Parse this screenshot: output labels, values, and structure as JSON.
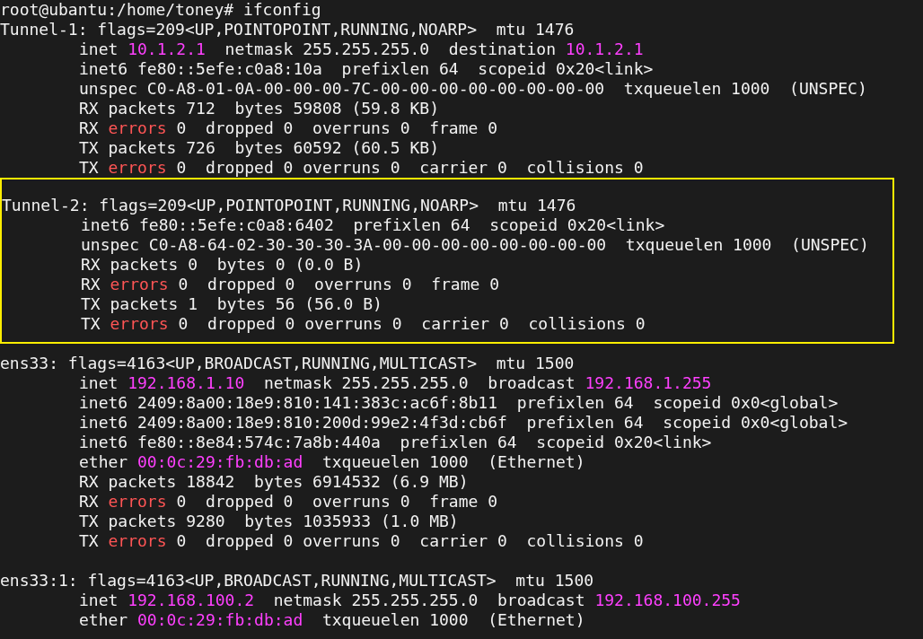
{
  "blocks": [
    {
      "highlighted": false,
      "lines": [
        {
          "indented": false,
          "segments": [
            {
              "kind": "text",
              "text": "root@ubantu:/home/toney# ifconfig"
            }
          ]
        },
        {
          "indented": false,
          "segments": [
            {
              "kind": "text",
              "text": "Tunnel-1: flags=209<UP,POINTOPOINT,RUNNING,NOARP>  mtu 1476"
            }
          ]
        },
        {
          "indented": true,
          "segments": [
            {
              "kind": "text",
              "text": "inet "
            },
            {
              "kind": "address",
              "text": "10.1.2.1"
            },
            {
              "kind": "text",
              "text": "  netmask 255.255.255.0  destination "
            },
            {
              "kind": "address",
              "text": "10.1.2.1"
            }
          ]
        },
        {
          "indented": true,
          "segments": [
            {
              "kind": "text",
              "text": "inet6 fe80::5efe:c0a8:10a  prefixlen 64  scopeid 0x20<link>"
            }
          ]
        },
        {
          "indented": true,
          "segments": [
            {
              "kind": "text",
              "text": "unspec C0-A8-01-0A-00-00-00-7C-00-00-00-00-00-00-00-00  txqueuelen 1000  (UNSPEC)"
            }
          ]
        },
        {
          "indented": true,
          "segments": [
            {
              "kind": "text",
              "text": "RX packets 712  bytes 59808 (59.8 KB)"
            }
          ]
        },
        {
          "indented": true,
          "segments": [
            {
              "kind": "text",
              "text": "RX "
            },
            {
              "kind": "error",
              "text": "errors"
            },
            {
              "kind": "text",
              "text": " 0  dropped 0  overruns 0  frame 0"
            }
          ]
        },
        {
          "indented": true,
          "segments": [
            {
              "kind": "text",
              "text": "TX packets 726  bytes 60592 (60.5 KB)"
            }
          ]
        },
        {
          "indented": true,
          "segments": [
            {
              "kind": "text",
              "text": "TX "
            },
            {
              "kind": "error",
              "text": "errors"
            },
            {
              "kind": "text",
              "text": " 0  dropped 0 overruns 0  carrier 0  collisions 0"
            }
          ]
        }
      ]
    },
    {
      "highlighted": true,
      "lines": [
        {
          "indented": false,
          "segments": [
            {
              "kind": "text",
              "text": "Tunnel-2: flags=209<UP,POINTOPOINT,RUNNING,NOARP>  mtu 1476"
            }
          ]
        },
        {
          "indented": true,
          "segments": [
            {
              "kind": "text",
              "text": "inet6 fe80::5efe:c0a8:6402  prefixlen 64  scopeid 0x20<link>"
            }
          ]
        },
        {
          "indented": true,
          "segments": [
            {
              "kind": "text",
              "text": "unspec C0-A8-64-02-30-30-30-3A-00-00-00-00-00-00-00-00  txqueuelen 1000  (UNSPEC)"
            }
          ]
        },
        {
          "indented": true,
          "segments": [
            {
              "kind": "text",
              "text": "RX packets 0  bytes 0 (0.0 B)"
            }
          ]
        },
        {
          "indented": true,
          "segments": [
            {
              "kind": "text",
              "text": "RX "
            },
            {
              "kind": "error",
              "text": "errors"
            },
            {
              "kind": "text",
              "text": " 0  dropped 0  overruns 0  frame 0"
            }
          ]
        },
        {
          "indented": true,
          "segments": [
            {
              "kind": "text",
              "text": "TX packets 1  bytes 56 (56.0 B)"
            }
          ]
        },
        {
          "indented": true,
          "segments": [
            {
              "kind": "text",
              "text": "TX "
            },
            {
              "kind": "error",
              "text": "errors"
            },
            {
              "kind": "text",
              "text": " 0  dropped 0 overruns 0  carrier 0  collisions 0"
            }
          ]
        }
      ]
    },
    {
      "highlighted": false,
      "lines": [
        {
          "indented": false,
          "segments": [
            {
              "kind": "text",
              "text": "ens33: flags=4163<UP,BROADCAST,RUNNING,MULTICAST>  mtu 1500"
            }
          ]
        },
        {
          "indented": true,
          "segments": [
            {
              "kind": "text",
              "text": "inet "
            },
            {
              "kind": "address",
              "text": "192.168.1.10"
            },
            {
              "kind": "text",
              "text": "  netmask 255.255.255.0  broadcast "
            },
            {
              "kind": "address",
              "text": "192.168.1.255"
            }
          ]
        },
        {
          "indented": true,
          "segments": [
            {
              "kind": "text",
              "text": "inet6 2409:8a00:18e9:810:141:383c:ac6f:8b11  prefixlen 64  scopeid 0x0<global>"
            }
          ]
        },
        {
          "indented": true,
          "segments": [
            {
              "kind": "text",
              "text": "inet6 2409:8a00:18e9:810:200d:99e2:4f3d:cb6f  prefixlen 64  scopeid 0x0<global>"
            }
          ]
        },
        {
          "indented": true,
          "segments": [
            {
              "kind": "text",
              "text": "inet6 fe80::8e84:574c:7a8b:440a  prefixlen 64  scopeid 0x20<link>"
            }
          ]
        },
        {
          "indented": true,
          "segments": [
            {
              "kind": "text",
              "text": "ether "
            },
            {
              "kind": "address",
              "text": "00:0c:29:fb:db:ad"
            },
            {
              "kind": "text",
              "text": "  txqueuelen 1000  (Ethernet)"
            }
          ]
        },
        {
          "indented": true,
          "segments": [
            {
              "kind": "text",
              "text": "RX packets 18842  bytes 6914532 (6.9 MB)"
            }
          ]
        },
        {
          "indented": true,
          "segments": [
            {
              "kind": "text",
              "text": "RX "
            },
            {
              "kind": "error",
              "text": "errors"
            },
            {
              "kind": "text",
              "text": " 0  dropped 0  overruns 0  frame 0"
            }
          ]
        },
        {
          "indented": true,
          "segments": [
            {
              "kind": "text",
              "text": "TX packets 9280  bytes 1035933 (1.0 MB)"
            }
          ]
        },
        {
          "indented": true,
          "segments": [
            {
              "kind": "text",
              "text": "TX "
            },
            {
              "kind": "error",
              "text": "errors"
            },
            {
              "kind": "text",
              "text": " 0  dropped 0 overruns 0  carrier 0  collisions 0"
            }
          ]
        }
      ]
    },
    {
      "highlighted": false,
      "lines": [
        {
          "indented": false,
          "segments": [
            {
              "kind": "text",
              "text": "ens33:1: flags=4163<UP,BROADCAST,RUNNING,MULTICAST>  mtu 1500"
            }
          ]
        },
        {
          "indented": true,
          "segments": [
            {
              "kind": "text",
              "text": "inet "
            },
            {
              "kind": "address",
              "text": "192.168.100.2"
            },
            {
              "kind": "text",
              "text": "  netmask 255.255.255.0  broadcast "
            },
            {
              "kind": "address",
              "text": "192.168.100.255"
            }
          ]
        },
        {
          "indented": true,
          "segments": [
            {
              "kind": "text",
              "text": "ether "
            },
            {
              "kind": "address",
              "text": "00:0c:29:fb:db:ad"
            },
            {
              "kind": "text",
              "text": "  txqueuelen 1000  (Ethernet)"
            }
          ]
        }
      ]
    }
  ]
}
